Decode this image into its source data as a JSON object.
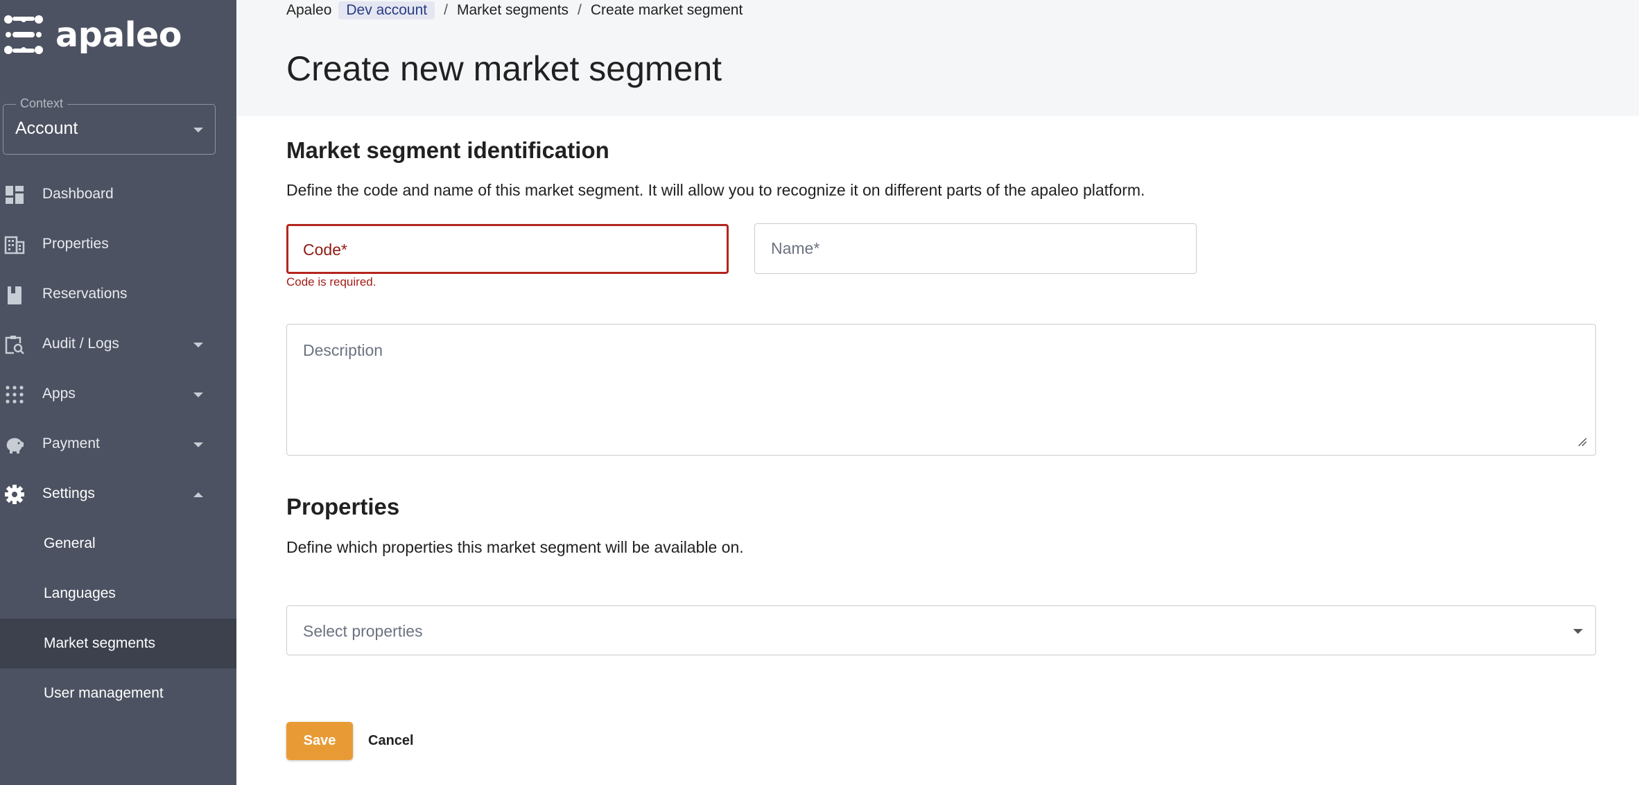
{
  "brand": {
    "name": "apaleo",
    "icon": "apaleo-logo-icon"
  },
  "context": {
    "legend": "Context",
    "value": "Account"
  },
  "nav": [
    {
      "label": "Dashboard",
      "icon": "dashboard-icon"
    },
    {
      "label": "Properties",
      "icon": "building-icon"
    },
    {
      "label": "Reservations",
      "icon": "booking-icon"
    },
    {
      "label": "Audit / Logs",
      "icon": "audit-search-icon"
    },
    {
      "label": "Apps",
      "icon": "apps-grid-icon"
    },
    {
      "label": "Payment",
      "icon": "piggy-bank-icon"
    },
    {
      "label": "Settings",
      "icon": "gear-icon"
    }
  ],
  "settings_sub": [
    {
      "label": "General"
    },
    {
      "label": "Languages"
    },
    {
      "label": "Market segments",
      "active": true
    },
    {
      "label": "User management"
    }
  ],
  "breadcrumb": {
    "root": "Apaleo",
    "account": "Dev account",
    "section": "Market segments",
    "current": "Create market segment",
    "separator": "/"
  },
  "page": {
    "title": "Create new market segment"
  },
  "identification": {
    "title": "Market segment identification",
    "description": "Define the code and name of this market segment. It will allow you to recognize it on different parts of the apaleo platform.",
    "code_placeholder": "Code*",
    "code_error": "Code is required.",
    "name_placeholder": "Name*",
    "description_placeholder": "Description"
  },
  "properties": {
    "title": "Properties",
    "description": "Define which properties this market segment will be available on.",
    "select_placeholder": "Select properties"
  },
  "actions": {
    "save": "Save",
    "cancel": "Cancel"
  },
  "colors": {
    "sidebar": "#4c5261",
    "sidebar_active": "#3c414d",
    "accent": "#e89b35",
    "error": "#b3261e",
    "chip": "#e4e7f1"
  }
}
